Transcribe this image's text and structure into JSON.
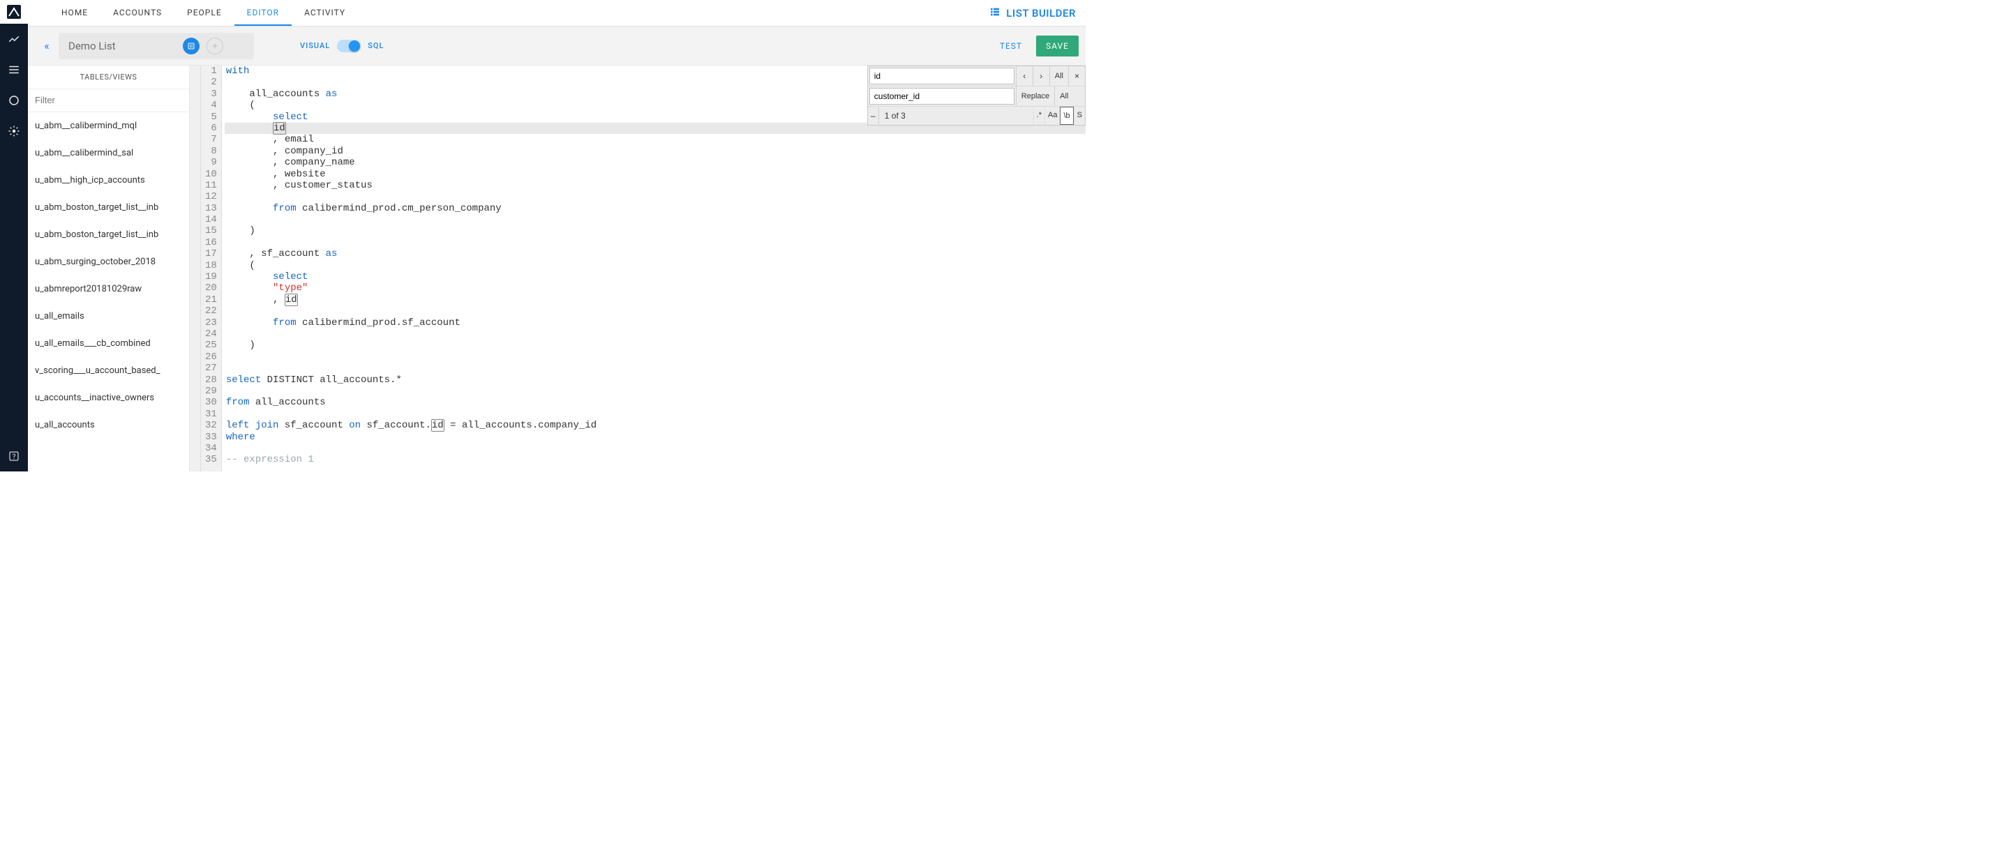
{
  "app": {
    "brand": "LIST BUILDER"
  },
  "topnav": {
    "items": [
      {
        "label": "HOME",
        "active": false
      },
      {
        "label": "ACCOUNTS",
        "active": false
      },
      {
        "label": "PEOPLE",
        "active": false
      },
      {
        "label": "EDITOR",
        "active": true
      },
      {
        "label": "ACTIVITY",
        "active": false
      }
    ]
  },
  "toolbar": {
    "collapse_glyph": "«",
    "list_title": "Demo List",
    "mode_visual": "VISUAL",
    "mode_sql": "SQL",
    "test_label": "TEST",
    "save_label": "SAVE"
  },
  "tables": {
    "header": "TABLES/VIEWS",
    "filter_placeholder": "Filter",
    "items": [
      "u_abm__calibermind_mql",
      "u_abm__calibermind_sal",
      "u_abm__high_icp_accounts",
      "u_abm_boston_target_list__inb",
      "u_abm_boston_target_list__inb",
      "u_abm_surging_october_2018",
      "u_abmreport20181029raw",
      "u_all_emails",
      "u_all_emails___cb_combined",
      "v_scoring___u_account_based_",
      "u_accounts__inactive_owners",
      "u_all_accounts"
    ]
  },
  "editor": {
    "highlight_line": 6,
    "lines": [
      {
        "n": 1,
        "tokens": [
          {
            "t": "with",
            "c": "kw"
          }
        ]
      },
      {
        "n": 2,
        "tokens": []
      },
      {
        "n": 3,
        "tokens": [
          {
            "t": "    all_accounts ",
            "c": ""
          },
          {
            "t": "as",
            "c": "kw"
          }
        ]
      },
      {
        "n": 4,
        "tokens": [
          {
            "t": "    (",
            "c": ""
          }
        ]
      },
      {
        "n": 5,
        "tokens": [
          {
            "t": "        ",
            "c": ""
          },
          {
            "t": "select",
            "c": "kw"
          }
        ]
      },
      {
        "n": 6,
        "tokens": [
          {
            "t": "        ",
            "c": ""
          },
          {
            "t": "id",
            "c": "mark"
          }
        ]
      },
      {
        "n": 7,
        "tokens": [
          {
            "t": "        , email",
            "c": ""
          }
        ]
      },
      {
        "n": 8,
        "tokens": [
          {
            "t": "        , company_id",
            "c": ""
          }
        ]
      },
      {
        "n": 9,
        "tokens": [
          {
            "t": "        , company_name",
            "c": ""
          }
        ]
      },
      {
        "n": 10,
        "tokens": [
          {
            "t": "        , website",
            "c": ""
          }
        ]
      },
      {
        "n": 11,
        "tokens": [
          {
            "t": "        , customer_status",
            "c": ""
          }
        ]
      },
      {
        "n": 12,
        "tokens": []
      },
      {
        "n": 13,
        "tokens": [
          {
            "t": "        ",
            "c": ""
          },
          {
            "t": "from",
            "c": "kw"
          },
          {
            "t": " calibermind_prod.cm_person_company",
            "c": ""
          }
        ]
      },
      {
        "n": 14,
        "tokens": []
      },
      {
        "n": 15,
        "tokens": [
          {
            "t": "    )",
            "c": ""
          }
        ]
      },
      {
        "n": 16,
        "tokens": []
      },
      {
        "n": 17,
        "tokens": [
          {
            "t": "    , sf_account ",
            "c": ""
          },
          {
            "t": "as",
            "c": "kw"
          }
        ]
      },
      {
        "n": 18,
        "tokens": [
          {
            "t": "    (",
            "c": ""
          }
        ]
      },
      {
        "n": 19,
        "tokens": [
          {
            "t": "        ",
            "c": ""
          },
          {
            "t": "select",
            "c": "kw"
          }
        ]
      },
      {
        "n": 20,
        "tokens": [
          {
            "t": "        ",
            "c": ""
          },
          {
            "t": "\"type\"",
            "c": "str"
          }
        ]
      },
      {
        "n": 21,
        "tokens": [
          {
            "t": "        , ",
            "c": ""
          },
          {
            "t": "id",
            "c": "mark"
          }
        ]
      },
      {
        "n": 22,
        "tokens": []
      },
      {
        "n": 23,
        "tokens": [
          {
            "t": "        ",
            "c": ""
          },
          {
            "t": "from",
            "c": "kw"
          },
          {
            "t": " calibermind_prod.sf_account",
            "c": ""
          }
        ]
      },
      {
        "n": 24,
        "tokens": []
      },
      {
        "n": 25,
        "tokens": [
          {
            "t": "    )",
            "c": ""
          }
        ]
      },
      {
        "n": 26,
        "tokens": []
      },
      {
        "n": 27,
        "tokens": []
      },
      {
        "n": 28,
        "tokens": [
          {
            "t": "select",
            "c": "kw"
          },
          {
            "t": " DISTINCT all_accounts.*",
            "c": ""
          }
        ]
      },
      {
        "n": 29,
        "tokens": []
      },
      {
        "n": 30,
        "tokens": [
          {
            "t": "from",
            "c": "kw"
          },
          {
            "t": " all_accounts",
            "c": ""
          }
        ]
      },
      {
        "n": 31,
        "tokens": []
      },
      {
        "n": 32,
        "tokens": [
          {
            "t": "left",
            "c": "kw"
          },
          {
            "t": " ",
            "c": ""
          },
          {
            "t": "join",
            "c": "kw"
          },
          {
            "t": " sf_account ",
            "c": ""
          },
          {
            "t": "on",
            "c": "kw"
          },
          {
            "t": " sf_account.",
            "c": ""
          },
          {
            "t": "id",
            "c": "mark"
          },
          {
            "t": " = all_accounts.company_id",
            "c": ""
          }
        ]
      },
      {
        "n": 33,
        "tokens": [
          {
            "t": "where",
            "c": "kw"
          }
        ]
      },
      {
        "n": 34,
        "tokens": []
      },
      {
        "n": 35,
        "tokens": [
          {
            "t": "-- expression 1",
            "c": "cm"
          }
        ]
      }
    ]
  },
  "find": {
    "search_value": "id",
    "replace_value": "customer_id",
    "prev": "‹",
    "next": "›",
    "all": "All",
    "replace_label": "Replace",
    "replace_all": "All",
    "close": "×",
    "twiddle": "–",
    "status": "1 of 3",
    "opts": {
      "regex": ".*",
      "case": "Aa",
      "word": "\\b",
      "sel": "S"
    },
    "active_opt": "word"
  }
}
